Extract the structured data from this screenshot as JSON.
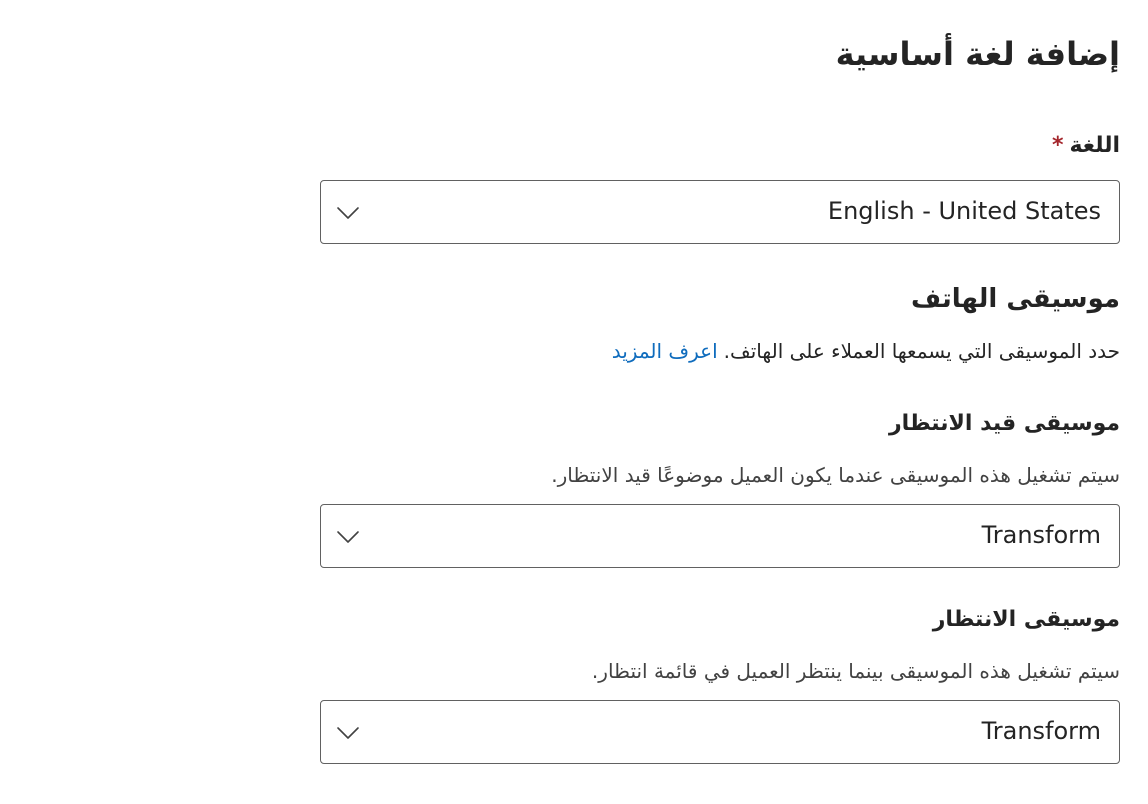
{
  "page": {
    "title": "إضافة لغة أساسية"
  },
  "language": {
    "label": "اللغة",
    "required_mark": "*",
    "selected": "English - United States",
    "icon": "chevron-down-icon"
  },
  "phone_music": {
    "title": "موسيقى الهاتف",
    "description": "حدد الموسيقى التي يسمعها العملاء على الهاتف.",
    "learn_more": "اعرف المزيد"
  },
  "hold_music": {
    "label": "موسيقى قيد الانتظار",
    "description": "سيتم تشغيل هذه الموسيقى عندما يكون العميل موضوعًا قيد الانتظار.",
    "selected": "Transform",
    "icon": "chevron-down-icon"
  },
  "wait_music": {
    "label": "موسيقى الانتظار",
    "description": "سيتم تشغيل هذه الموسيقى بينما ينتظر العميل في قائمة انتظار.",
    "selected": "Transform",
    "icon": "chevron-down-icon"
  },
  "colors": {
    "link": "#0f6cbd",
    "required": "#a4262c",
    "border": "#616161",
    "text": "#242424"
  }
}
